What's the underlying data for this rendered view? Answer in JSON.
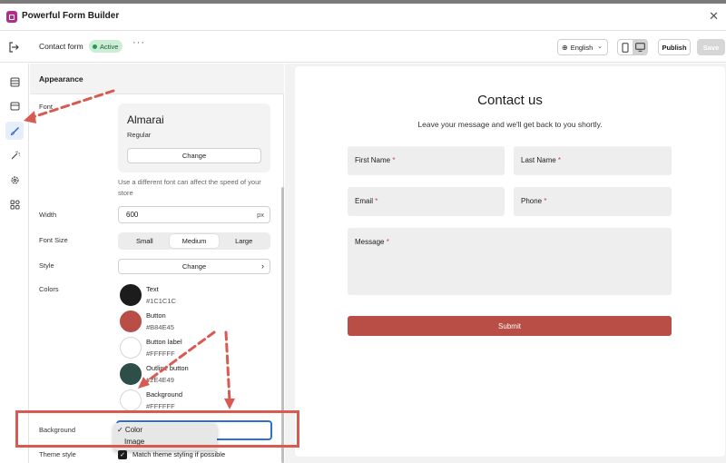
{
  "app": {
    "title": "Powerful Form Builder"
  },
  "toolbar": {
    "form_name": "Contact form",
    "status": "Active",
    "more_label": "···",
    "language": "English",
    "publish_label": "Publish",
    "save_label": "Save"
  },
  "sidebar": {
    "items": [
      {
        "icon": "fields-icon"
      },
      {
        "icon": "message-icon"
      },
      {
        "icon": "brush-icon",
        "active": true
      },
      {
        "icon": "magic-icon"
      },
      {
        "icon": "settings-icon"
      },
      {
        "icon": "apps-icon"
      }
    ]
  },
  "panel": {
    "title": "Appearance",
    "font": {
      "label": "Font",
      "name": "Almarai",
      "weight": "Regular",
      "change_label": "Change",
      "note": "Use a different font can affect the speed of your store"
    },
    "width": {
      "label": "Width",
      "value": "600",
      "unit": "px"
    },
    "font_size": {
      "label": "Font Size",
      "options": [
        "Small",
        "Medium",
        "Large"
      ],
      "selected": "Medium"
    },
    "style": {
      "label": "Style",
      "button_label": "Change"
    },
    "colors": {
      "label": "Colors",
      "items": [
        {
          "name": "Text",
          "hex": "#1C1C1C"
        },
        {
          "name": "Button",
          "hex": "#B84E45"
        },
        {
          "name": "Button label",
          "hex": "#FFFFFF"
        },
        {
          "name": "Outline button",
          "hex": "#2E4E49"
        },
        {
          "name": "Background",
          "hex": "#FFFFFF"
        }
      ]
    },
    "background": {
      "label": "Background",
      "options": [
        "✓ Color",
        "Image"
      ]
    },
    "theme_style": {
      "label": "Theme style",
      "checkbox_label": "Match theme styling if possible"
    }
  },
  "preview": {
    "title": "Contact us",
    "subtitle": "Leave your message and we'll get back to you shortly.",
    "fields": {
      "first_name": "First Name",
      "last_name": "Last Name",
      "email": "Email",
      "phone": "Phone",
      "message": "Message",
      "required_mark": "*"
    },
    "submit_label": "Submit"
  },
  "annotation_color": "#D95A50"
}
